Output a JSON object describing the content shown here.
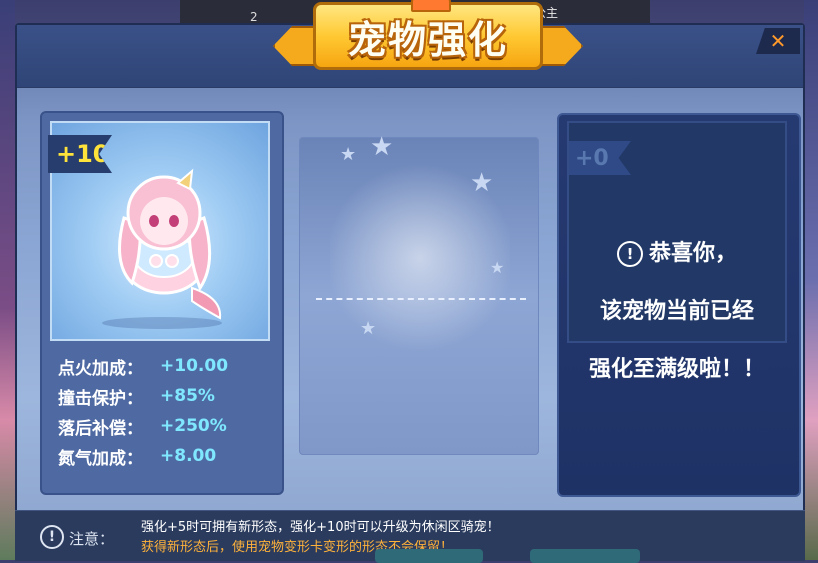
{
  "background": {
    "top_label": "人鱼公主",
    "top_small": "2"
  },
  "window": {
    "title": "宠物强化",
    "close_label": "✕"
  },
  "left_card": {
    "level": "+10",
    "stats": [
      {
        "label": "点火加成：",
        "value": "+10.00"
      },
      {
        "label": "撞击保护：",
        "value": "+85%"
      },
      {
        "label": "落后补偿：",
        "value": "+250%"
      },
      {
        "label": "氮气加成：",
        "value": "+8.00"
      }
    ]
  },
  "right_card": {
    "level": "+0",
    "message_line1": "恭喜你，",
    "message_line2": "该宠物当前已经",
    "message_line3": "强化至满级啦！！"
  },
  "footer": {
    "note_label": "注意：",
    "note_line1": "强化+5时可拥有新形态，强化+10时可以升级为休闲区骑宠！",
    "note_line2": "获得新形态后，使用宠物变形卡变形的形态不会保留！"
  },
  "colors": {
    "accent_gold": "#ffc933",
    "stat_value": "#7fe8ff",
    "warning_orange": "#ffb23a",
    "close_orange": "#ff9a2a"
  }
}
